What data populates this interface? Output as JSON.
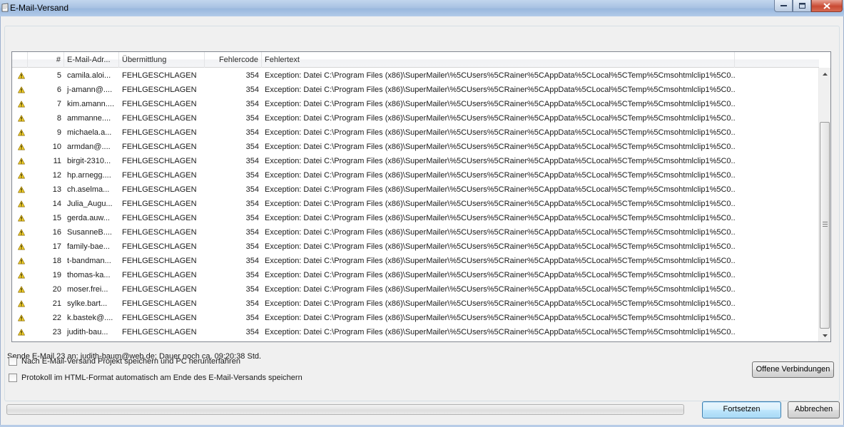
{
  "window": {
    "title": "E-Mail-Versand"
  },
  "list": {
    "columns": [
      "#",
      "E-Mail-Adr...",
      "Übermittlung",
      "Fehlercode",
      "Fehlertext"
    ],
    "rows": [
      {
        "num": "5",
        "mail": "camila.aloi...",
        "state": "FEHLGESCHLAGEN",
        "code": "354",
        "text": "Exception: Datei C:\\Program Files (x86)\\SuperMailer\\%5CUsers%5CRainer%5CAppData%5CLocal%5CTemp%5Cmsohtmlclip1%5C0..."
      },
      {
        "num": "6",
        "mail": "j-amann@....",
        "state": "FEHLGESCHLAGEN",
        "code": "354",
        "text": "Exception: Datei C:\\Program Files (x86)\\SuperMailer\\%5CUsers%5CRainer%5CAppData%5CLocal%5CTemp%5Cmsohtmlclip1%5C0..."
      },
      {
        "num": "7",
        "mail": "kim.amann....",
        "state": "FEHLGESCHLAGEN",
        "code": "354",
        "text": "Exception: Datei C:\\Program Files (x86)\\SuperMailer\\%5CUsers%5CRainer%5CAppData%5CLocal%5CTemp%5Cmsohtmlclip1%5C0..."
      },
      {
        "num": "8",
        "mail": "ammanne....",
        "state": "FEHLGESCHLAGEN",
        "code": "354",
        "text": "Exception: Datei C:\\Program Files (x86)\\SuperMailer\\%5CUsers%5CRainer%5CAppData%5CLocal%5CTemp%5Cmsohtmlclip1%5C0..."
      },
      {
        "num": "9",
        "mail": "michaela.a...",
        "state": "FEHLGESCHLAGEN",
        "code": "354",
        "text": "Exception: Datei C:\\Program Files (x86)\\SuperMailer\\%5CUsers%5CRainer%5CAppData%5CLocal%5CTemp%5Cmsohtmlclip1%5C0..."
      },
      {
        "num": "10",
        "mail": "armdan@....",
        "state": "FEHLGESCHLAGEN",
        "code": "354",
        "text": "Exception: Datei C:\\Program Files (x86)\\SuperMailer\\%5CUsers%5CRainer%5CAppData%5CLocal%5CTemp%5Cmsohtmlclip1%5C0..."
      },
      {
        "num": "11",
        "mail": "birgit-2310...",
        "state": "FEHLGESCHLAGEN",
        "code": "354",
        "text": "Exception: Datei C:\\Program Files (x86)\\SuperMailer\\%5CUsers%5CRainer%5CAppData%5CLocal%5CTemp%5Cmsohtmlclip1%5C0..."
      },
      {
        "num": "12",
        "mail": "hp.arnegg....",
        "state": "FEHLGESCHLAGEN",
        "code": "354",
        "text": "Exception: Datei C:\\Program Files (x86)\\SuperMailer\\%5CUsers%5CRainer%5CAppData%5CLocal%5CTemp%5Cmsohtmlclip1%5C0..."
      },
      {
        "num": "13",
        "mail": "ch.aselma...",
        "state": "FEHLGESCHLAGEN",
        "code": "354",
        "text": "Exception: Datei C:\\Program Files (x86)\\SuperMailer\\%5CUsers%5CRainer%5CAppData%5CLocal%5CTemp%5Cmsohtmlclip1%5C0..."
      },
      {
        "num": "14",
        "mail": "Julia_Augu...",
        "state": "FEHLGESCHLAGEN",
        "code": "354",
        "text": "Exception: Datei C:\\Program Files (x86)\\SuperMailer\\%5CUsers%5CRainer%5CAppData%5CLocal%5CTemp%5Cmsohtmlclip1%5C0..."
      },
      {
        "num": "15",
        "mail": "gerda.auw...",
        "state": "FEHLGESCHLAGEN",
        "code": "354",
        "text": "Exception: Datei C:\\Program Files (x86)\\SuperMailer\\%5CUsers%5CRainer%5CAppData%5CLocal%5CTemp%5Cmsohtmlclip1%5C0..."
      },
      {
        "num": "16",
        "mail": "SusanneB....",
        "state": "FEHLGESCHLAGEN",
        "code": "354",
        "text": "Exception: Datei C:\\Program Files (x86)\\SuperMailer\\%5CUsers%5CRainer%5CAppData%5CLocal%5CTemp%5Cmsohtmlclip1%5C0..."
      },
      {
        "num": "17",
        "mail": "family-bae...",
        "state": "FEHLGESCHLAGEN",
        "code": "354",
        "text": "Exception: Datei C:\\Program Files (x86)\\SuperMailer\\%5CUsers%5CRainer%5CAppData%5CLocal%5CTemp%5Cmsohtmlclip1%5C0..."
      },
      {
        "num": "18",
        "mail": "t-bandman...",
        "state": "FEHLGESCHLAGEN",
        "code": "354",
        "text": "Exception: Datei C:\\Program Files (x86)\\SuperMailer\\%5CUsers%5CRainer%5CAppData%5CLocal%5CTemp%5Cmsohtmlclip1%5C0..."
      },
      {
        "num": "19",
        "mail": "thomas-ka...",
        "state": "FEHLGESCHLAGEN",
        "code": "354",
        "text": "Exception: Datei C:\\Program Files (x86)\\SuperMailer\\%5CUsers%5CRainer%5CAppData%5CLocal%5CTemp%5Cmsohtmlclip1%5C0..."
      },
      {
        "num": "20",
        "mail": "moser.frei...",
        "state": "FEHLGESCHLAGEN",
        "code": "354",
        "text": "Exception: Datei C:\\Program Files (x86)\\SuperMailer\\%5CUsers%5CRainer%5CAppData%5CLocal%5CTemp%5Cmsohtmlclip1%5C0..."
      },
      {
        "num": "21",
        "mail": "sylke.bart...",
        "state": "FEHLGESCHLAGEN",
        "code": "354",
        "text": "Exception: Datei C:\\Program Files (x86)\\SuperMailer\\%5CUsers%5CRainer%5CAppData%5CLocal%5CTemp%5Cmsohtmlclip1%5C0..."
      },
      {
        "num": "22",
        "mail": "k.bastek@....",
        "state": "FEHLGESCHLAGEN",
        "code": "354",
        "text": "Exception: Datei C:\\Program Files (x86)\\SuperMailer\\%5CUsers%5CRainer%5CAppData%5CLocal%5CTemp%5Cmsohtmlclip1%5C0..."
      },
      {
        "num": "23",
        "mail": "judith-bau...",
        "state": "FEHLGESCHLAGEN",
        "code": "354",
        "text": "Exception: Datei C:\\Program Files (x86)\\SuperMailer\\%5CUsers%5CRainer%5CAppData%5CLocal%5CTemp%5Cmsohtmlclip1%5C0..."
      }
    ],
    "row_icon": "warning-icon"
  },
  "status_text": "Sende E-Mail 23 an: judith-baum@web.de; Dauer noch ca. 09:20:38 Std.",
  "options": {
    "shutdown_label": "Nach E-Mail-Versand Projekt speichern und PC herunterfahren",
    "shutdown_checked": false,
    "html_log_label": "Protokoll im HTML-Format automatisch am Ende des E-Mail-Versands speichern",
    "html_log_checked": false
  },
  "buttons": {
    "open_connections": "Offene Verbindungen",
    "continue": "Fortsetzen",
    "cancel": "Abbrechen"
  },
  "progress": {
    "value": 0
  },
  "colors": {
    "warning": "#f5d32a",
    "accent": "#3c7fb1"
  }
}
